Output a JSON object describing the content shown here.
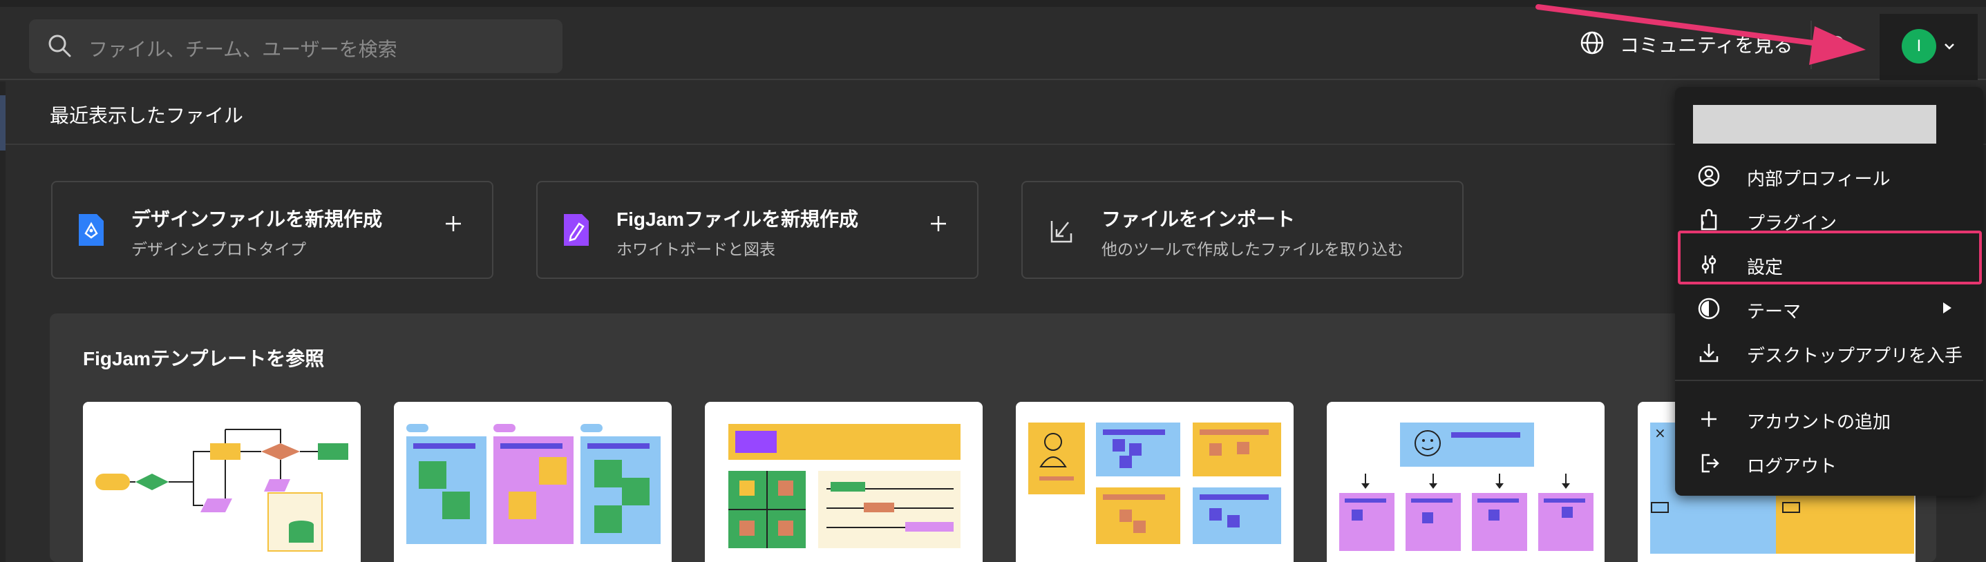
{
  "header": {
    "search_placeholder": "ファイル、チーム、ユーザーを検索",
    "community_label": "コミュニティを見る",
    "avatar_initial": "I"
  },
  "recent": {
    "title": "最近表示したファイル"
  },
  "create_cards": [
    {
      "title": "デザインファイルを新規作成",
      "subtitle": "デザインとプロトタイプ",
      "icon": "design-file-icon",
      "color": "#2d7ff9"
    },
    {
      "title": "FigJamファイルを新規作成",
      "subtitle": "ホワイトボードと図表",
      "icon": "figjam-file-icon",
      "color": "#9747ff"
    },
    {
      "title": "ファイルをインポート",
      "subtitle": "他のツールで作成したファイルを取り込む",
      "icon": "import-icon"
    }
  ],
  "templates": {
    "title": "FigJamテンプレートを参照"
  },
  "account_menu": {
    "items": [
      {
        "label": "内部プロフィール",
        "icon": "profile-icon"
      },
      {
        "label": "プラグイン",
        "icon": "plugin-icon"
      },
      {
        "label": "設定",
        "icon": "settings-sliders-icon"
      },
      {
        "label": "テーマ",
        "icon": "theme-icon"
      },
      {
        "label": "デスクトップアプリを入手",
        "icon": "download-icon"
      },
      {
        "label": "アカウントの追加",
        "icon": "plus-icon"
      },
      {
        "label": "ログアウト",
        "icon": "logout-icon"
      }
    ]
  },
  "colors": {
    "background": "#2c2c2c",
    "menu_bg": "#1e1e1e",
    "highlight": "#e6356f",
    "avatar": "#14ae5c"
  }
}
